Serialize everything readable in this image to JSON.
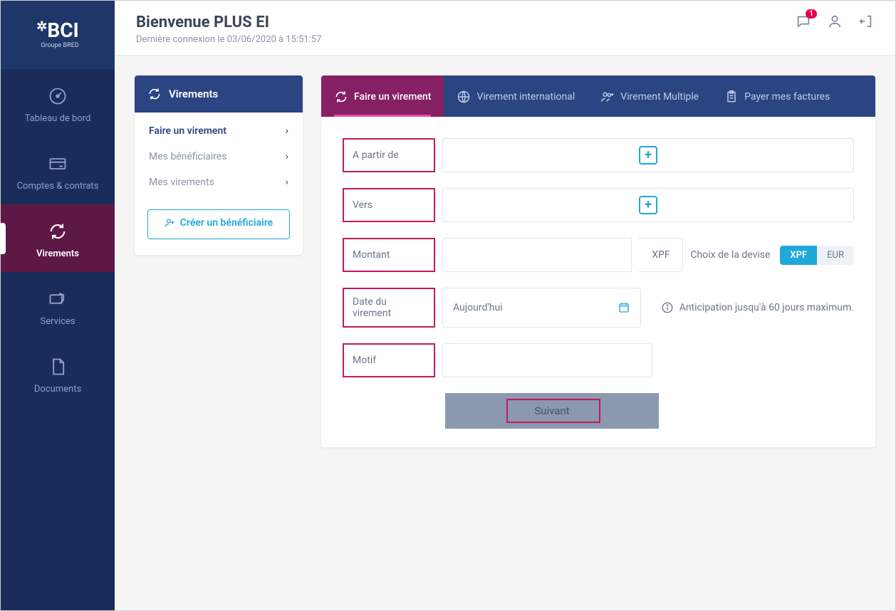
{
  "logo": {
    "main": "BCI",
    "sub": "Groupe BRED"
  },
  "nav": [
    {
      "label": "Tableau de bord"
    },
    {
      "label": "Comptes & contrats"
    },
    {
      "label": "Virements"
    },
    {
      "label": "Services"
    },
    {
      "label": "Documents"
    }
  ],
  "header": {
    "title": "Bienvenue PLUS EI",
    "lastLogin": "Dernière connexion le 03/06/2020 à 15:51:57",
    "badge": "1"
  },
  "leftCard": {
    "title": "Virements",
    "items": [
      {
        "label": "Faire un virement"
      },
      {
        "label": "Mes bénéficiaires"
      },
      {
        "label": "Mes virements"
      }
    ],
    "createBtn": "Créer un bénéficiaire"
  },
  "tabs": [
    {
      "label": "Faire un virement"
    },
    {
      "label": "Virement international"
    },
    {
      "label": "Virement Multiple"
    },
    {
      "label": "Payer mes factures"
    }
  ],
  "form": {
    "from": "A partir de",
    "to": "Vers",
    "amount": "Montant",
    "amountCurrency": "XPF",
    "currencyChoiceLabel": "Choix de la devise",
    "currencyOptions": {
      "xpf": "XPF",
      "eur": "EUR"
    },
    "date": "Date du virement",
    "dateValue": "Aujourd'hui",
    "dateHint": "Anticipation jusqu'à 60 jours maximum.",
    "motif": "Motif",
    "submit": "Suivant"
  }
}
